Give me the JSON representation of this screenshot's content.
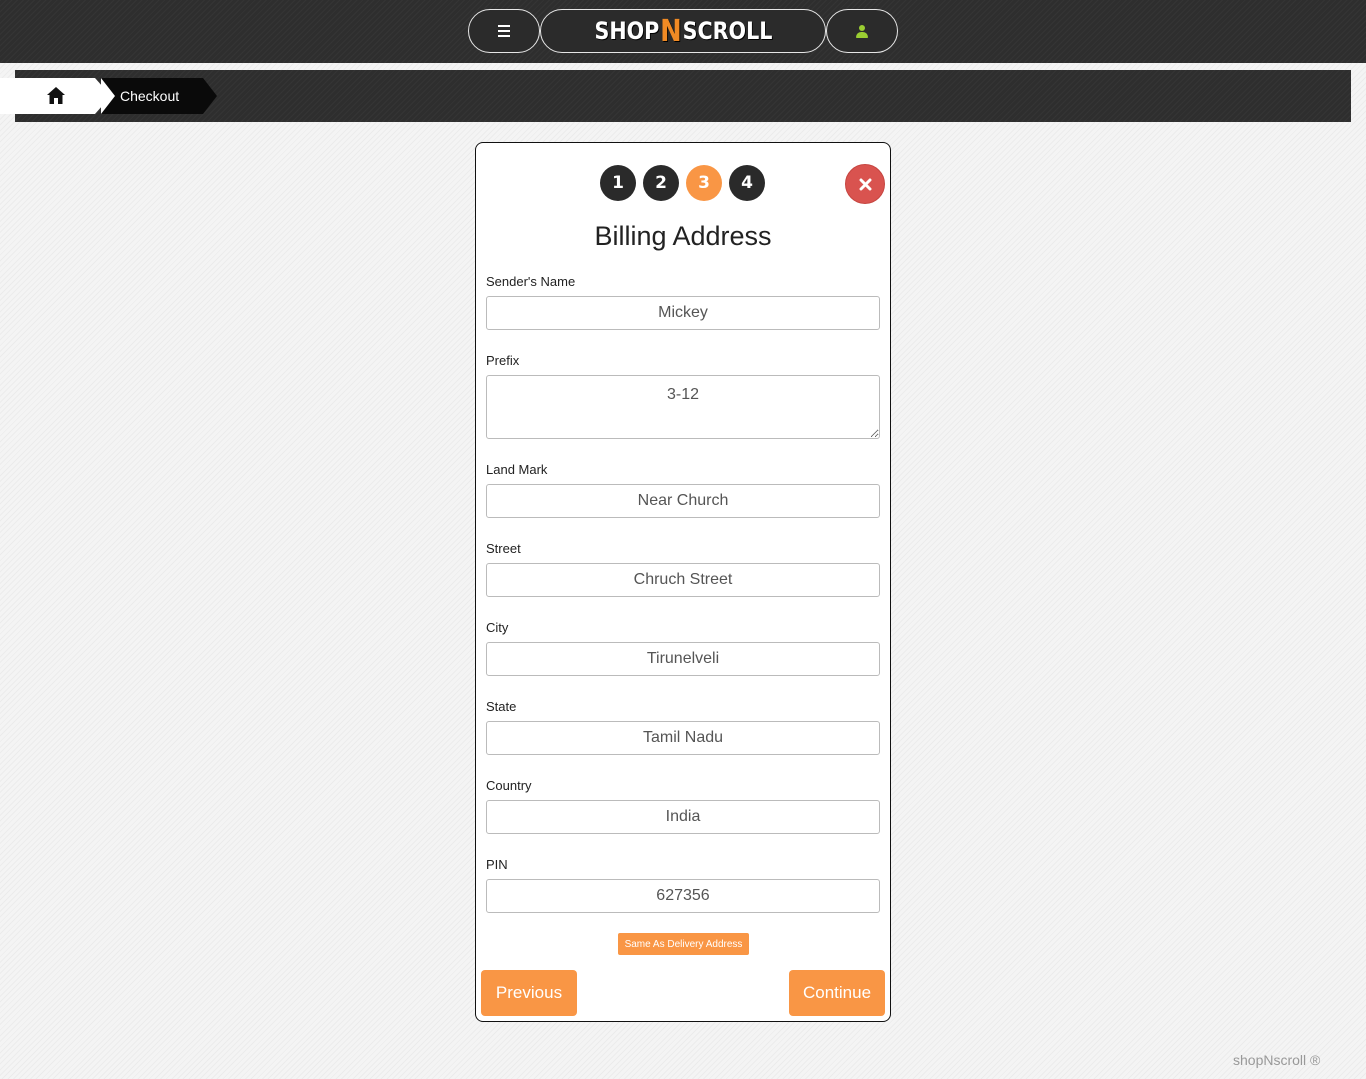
{
  "header": {
    "logo_left": "SHOP",
    "logo_mid": "N",
    "logo_right": "SCROLL",
    "menu_icon": "hamburger-menu-icon",
    "user_icon": "user-icon",
    "accent_color": "#9acd32"
  },
  "breadcrumb": {
    "home_icon": "home-icon",
    "current": "Checkout"
  },
  "checkout": {
    "steps": [
      "1",
      "2",
      "3",
      "4"
    ],
    "active_step": 3,
    "close_icon": "close-icon",
    "title": "Billing Address",
    "fields": [
      {
        "label": "Sender's Name",
        "value": "Mickey"
      },
      {
        "label": "Prefix",
        "value": "3-12"
      },
      {
        "label": "Land Mark",
        "value": "Near Church"
      },
      {
        "label": "Street",
        "value": "Chruch Street"
      },
      {
        "label": "City",
        "value": "Tirunelveli"
      },
      {
        "label": "State",
        "value": "Tamil Nadu"
      },
      {
        "label": "Country",
        "value": "India"
      },
      {
        "label": "PIN",
        "value": "627356"
      }
    ],
    "same_as_delivery_label": "Same As Delivery Address",
    "previous_label": "Previous",
    "continue_label": "Continue",
    "button_color": "#f99645",
    "close_color": "#d9534f"
  },
  "footer": {
    "text": "shopNscroll ®"
  }
}
